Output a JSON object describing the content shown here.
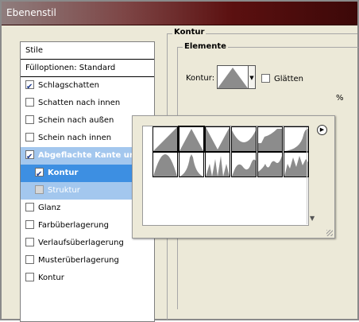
{
  "window": {
    "title": "Ebenenstil"
  },
  "style_list": {
    "header": "Stile",
    "fill_options": "Fülloptionen: Standard",
    "items": [
      {
        "label": "Schlagschatten",
        "checked": true
      },
      {
        "label": "Schatten nach innen",
        "checked": false
      },
      {
        "label": "Schein nach außen",
        "checked": false
      },
      {
        "label": "Schein nach innen",
        "checked": false
      },
      {
        "label": "Abgeflachte Kante und R",
        "checked": true
      },
      {
        "label": "Kontur",
        "checked": true
      },
      {
        "label": "Struktur",
        "checked": false
      },
      {
        "label": "Glanz",
        "checked": false
      },
      {
        "label": "Farbüberlagerung",
        "checked": false
      },
      {
        "label": "Verlaufsüberlagerung",
        "checked": false
      },
      {
        "label": "Musterüberlagerung",
        "checked": false
      },
      {
        "label": "Kontur",
        "checked": false
      }
    ]
  },
  "panel": {
    "section_title": "Kontur",
    "subsection_title": "Elemente",
    "contour_label": "Kontur:",
    "smooth_label": "Glätten",
    "smooth_checked": false,
    "percent_fragment": "%"
  },
  "contour_picker": {
    "icons": [
      "linear-contour",
      "cone-contour",
      "cone-inverted-contour",
      "cove-deep-contour",
      "cove-shallow-contour",
      "gaussian-contour",
      "half-round-contour",
      "ring-contour",
      "ring-double-contour",
      "rolling-slope-contour",
      "rounded-steps-contour",
      "sawtooth-contour"
    ],
    "selected_index": 1
  }
}
